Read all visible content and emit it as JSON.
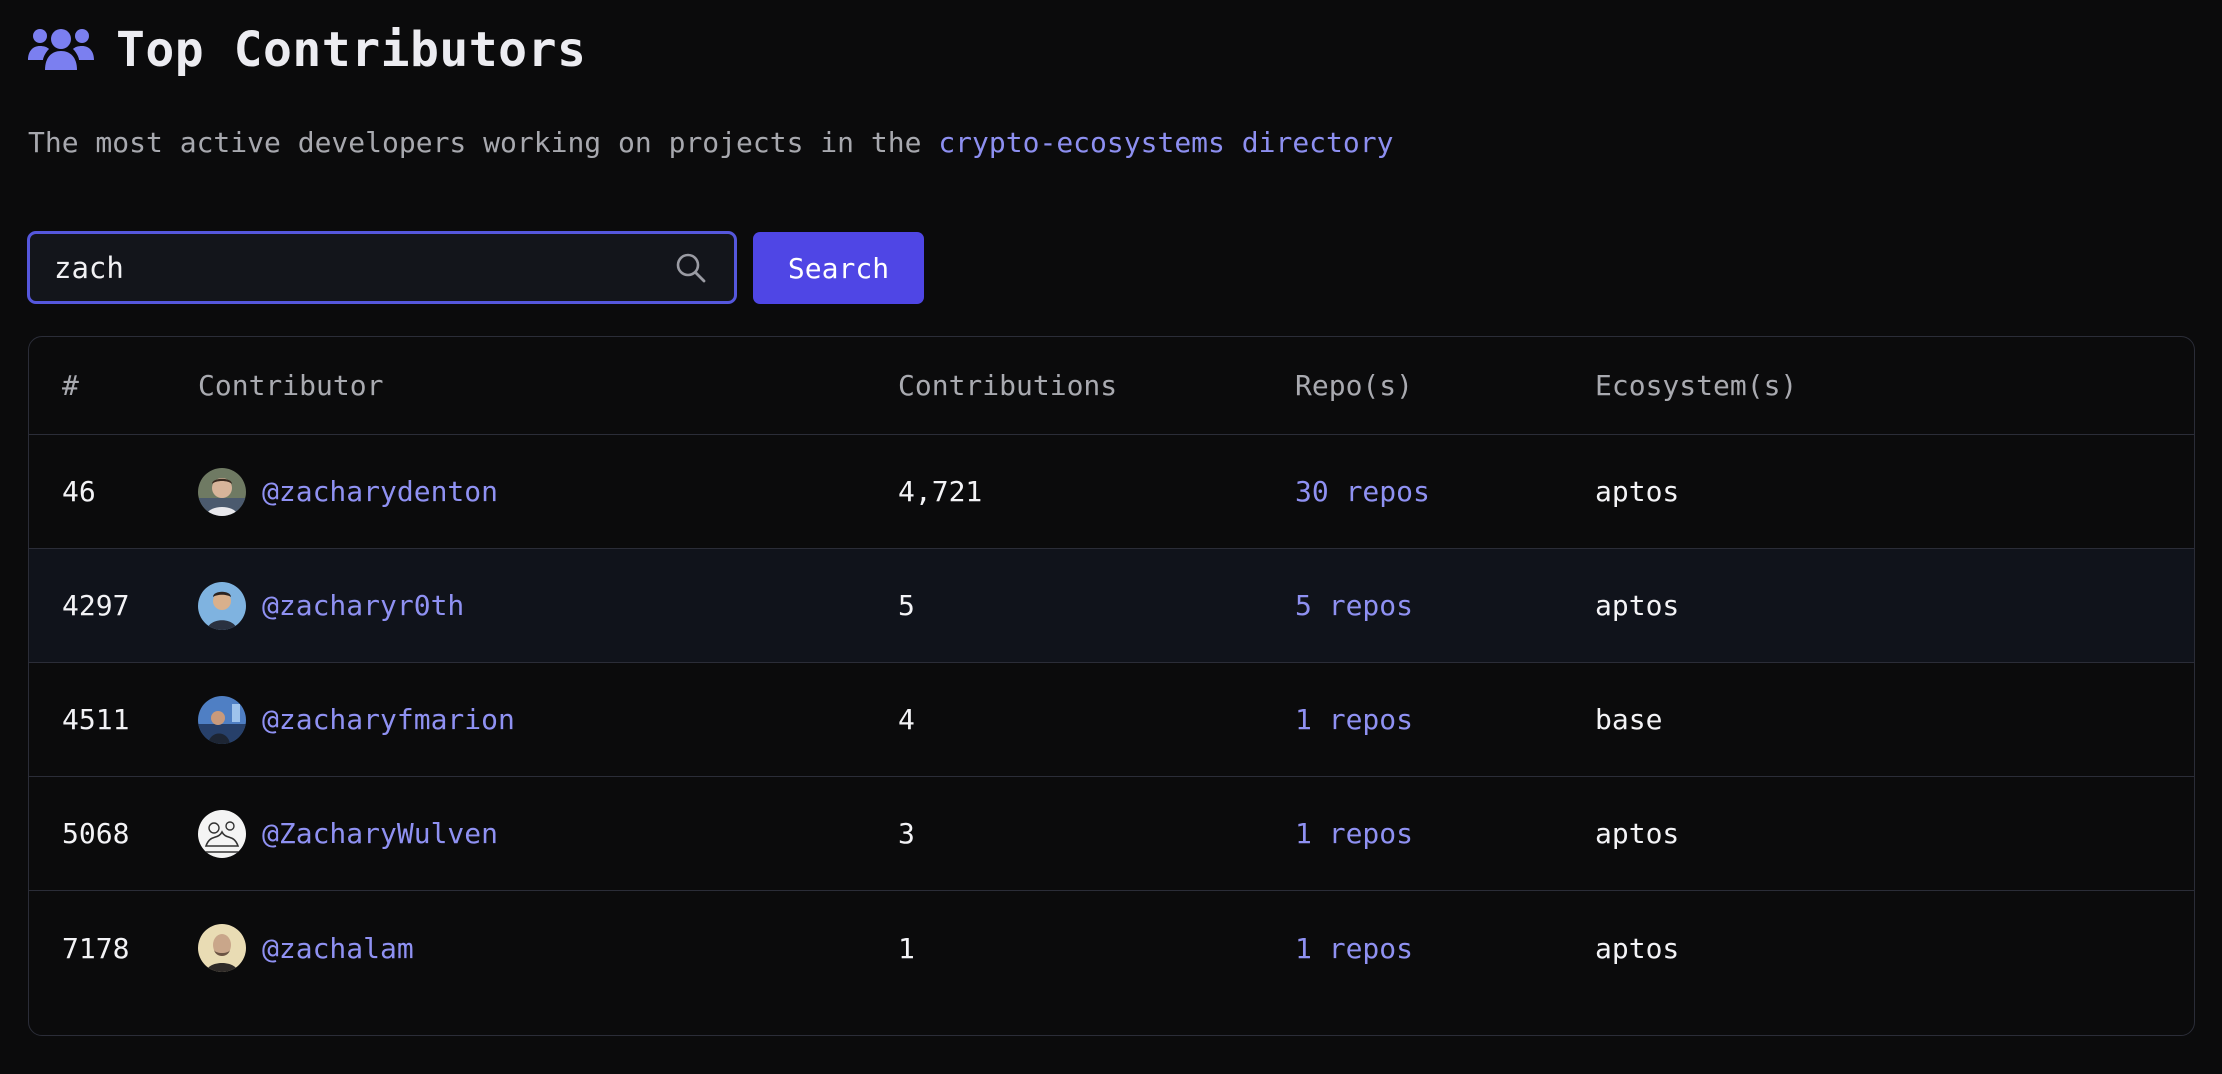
{
  "page": {
    "title": "Top Contributors",
    "title_icon": "users-icon",
    "subtitle_text": "The most active developers working on projects in the ",
    "subtitle_link": "crypto-ecosystems directory"
  },
  "search": {
    "value": "zach",
    "placeholder": "",
    "icon": "search-icon",
    "button_label": "Search"
  },
  "colors": {
    "background": "#0b0b0c",
    "accent": "#4f46e5",
    "link": "#8f91f2"
  },
  "table": {
    "headers": {
      "rank": "#",
      "contributor": "Contributor",
      "contributions": "Contributions",
      "repos": "Repo(s)",
      "ecosystems": "Ecosystem(s)"
    },
    "rows": [
      {
        "rank": "46",
        "handle": "@zacharydenton",
        "contributions": "4,721",
        "repos": "30 repos",
        "ecosystems": "aptos"
      },
      {
        "rank": "4297",
        "handle": "@zacharyr0th",
        "contributions": "5",
        "repos": "5 repos",
        "ecosystems": "aptos"
      },
      {
        "rank": "4511",
        "handle": "@zacharyfmarion",
        "contributions": "4",
        "repos": "1 repos",
        "ecosystems": "base"
      },
      {
        "rank": "5068",
        "handle": "@ZacharyWulven",
        "contributions": "3",
        "repos": "1 repos",
        "ecosystems": "aptos"
      },
      {
        "rank": "7178",
        "handle": "@zachalam",
        "contributions": "1",
        "repos": "1 repos",
        "ecosystems": "aptos"
      }
    ]
  }
}
